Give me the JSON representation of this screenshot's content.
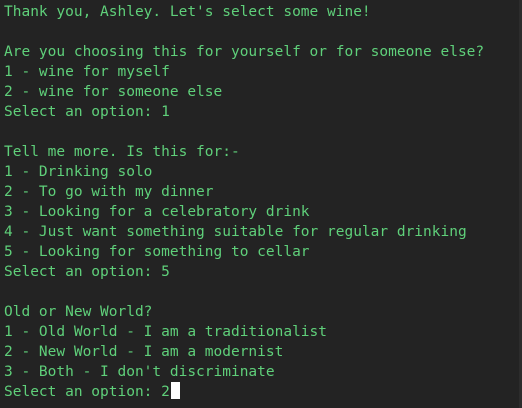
{
  "terminal": {
    "lines": [
      "Thank you, Ashley. Let's select some wine!",
      "",
      "Are you choosing this for yourself or for someone else?",
      "1 - wine for myself",
      "2 - wine for someone else",
      "Select an option: 1",
      "",
      "Tell me more. Is this for:-",
      "1 - Drinking solo",
      "2 - To go with my dinner",
      "3 - Looking for a celebratory drink",
      "4 - Just want something suitable for regular drinking",
      "5 - Looking for something to cellar",
      "Select an option: 5",
      "",
      "Old or New World?",
      "1 - Old World - I am a traditionalist",
      "2 - New World - I am a modernist",
      "3 - Both - I don't discriminate"
    ],
    "prompt": "Select an option: 2"
  },
  "colors": {
    "background": "#232323",
    "text": "#5fd07a",
    "cursor": "#ffffff"
  }
}
